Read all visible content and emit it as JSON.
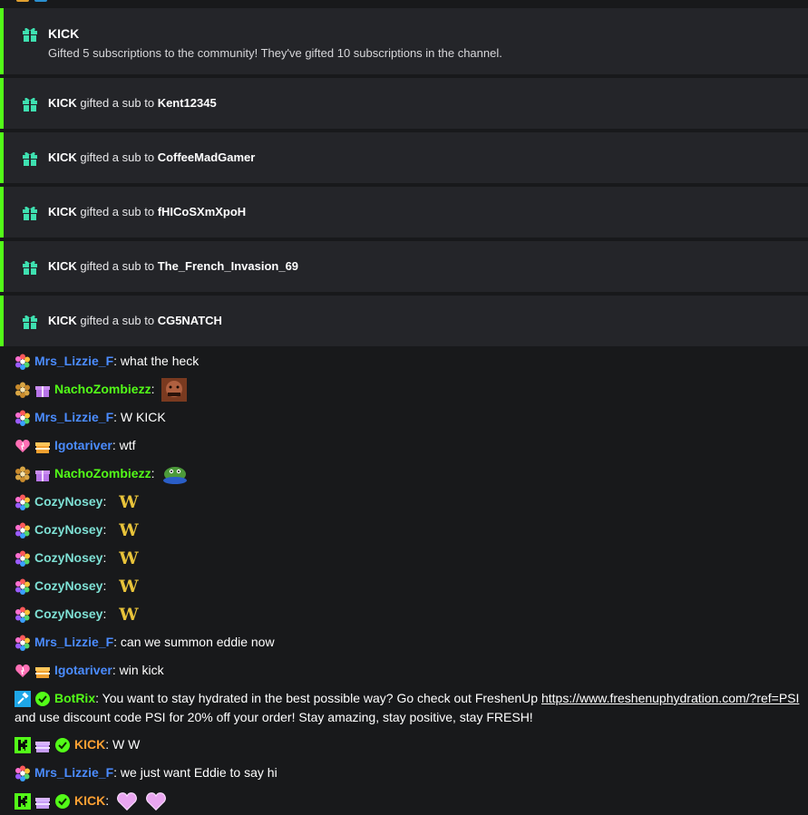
{
  "colors": {
    "green_accent": "#53fc18",
    "teal_accent": "#3ee0b0",
    "blue_user": "#4b8cff",
    "green_user": "#53fc18",
    "orange_user": "#ffa133",
    "pink_badge": "#e27fd6",
    "kick_green": "#53fc18"
  },
  "gift_events": {
    "main": {
      "title": "KICK",
      "text": "Gifted 5 subscriptions to the community! They've gifted 10 subscriptions in the channel."
    },
    "subs": [
      {
        "gifter": "KICK",
        "verb": " gifted a sub to ",
        "recipient": "Kent12345"
      },
      {
        "gifter": "KICK",
        "verb": " gifted a sub to ",
        "recipient": "CoffeeMadGamer"
      },
      {
        "gifter": "KICK",
        "verb": " gifted a sub to ",
        "recipient": "fHICoSXmXpoH"
      },
      {
        "gifter": "KICK",
        "verb": " gifted a sub to ",
        "recipient": "The_French_Invasion_69"
      },
      {
        "gifter": "KICK",
        "verb": " gifted a sub to ",
        "recipient": "CG5NATCH"
      }
    ]
  },
  "chat": [
    {
      "user": "Mrs_Lizzie_F",
      "text": " what the heck"
    },
    {
      "user": "NachoZombiezz",
      "text": ""
    },
    {
      "user": "Mrs_Lizzie_F",
      "text": " W KICK"
    },
    {
      "user": "Igotariver",
      "text": " wtf"
    },
    {
      "user": "NachoZombiezz",
      "text": ""
    },
    {
      "user": "CozyNosey",
      "text": ""
    },
    {
      "user": "CozyNosey",
      "text": ""
    },
    {
      "user": "CozyNosey",
      "text": ""
    },
    {
      "user": "CozyNosey",
      "text": ""
    },
    {
      "user": "CozyNosey",
      "text": ""
    },
    {
      "user": "Mrs_Lizzie_F",
      "text": " can we summon eddie now"
    },
    {
      "user": "Igotariver",
      "text": " win kick"
    },
    {
      "user": "BotRix",
      "text": " You want to stay hydrated in the best possible way? Go check out FreshenUp ",
      "link": "https://www.freshenuphydration.com/?ref=PSI",
      "text2": "and use discount code PSI for 20% off your order! Stay amazing, stay positive, stay FRESH!"
    },
    {
      "user": "KICK",
      "text": " W W"
    },
    {
      "user": "Mrs_Lizzie_F",
      "text": " we just want Eddie to say hi"
    },
    {
      "user": "KICK",
      "text": ""
    }
  ],
  "separator": ":",
  "emote_w": "W"
}
